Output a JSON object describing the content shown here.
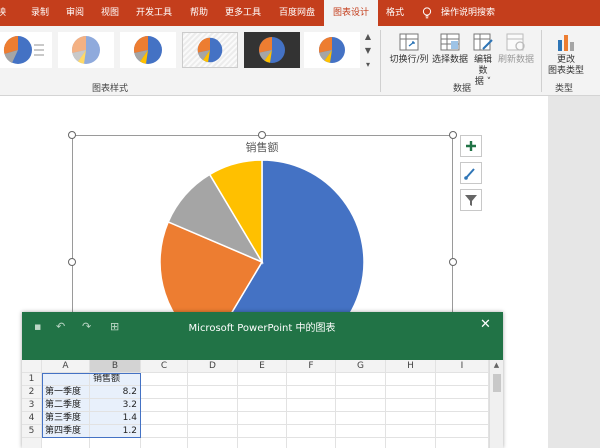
{
  "ribbon": {
    "tabs": [
      "映",
      "录制",
      "审阅",
      "视图",
      "开发工具",
      "帮助",
      "更多工具",
      "百度网盘",
      "图表设计",
      "格式"
    ],
    "active_tab": "图表设计",
    "search_label": "操作说明搜索",
    "groups": {
      "chart_styles": "图表样式",
      "data": "数据",
      "type": "类型"
    },
    "buttons": {
      "switch_row_col": "切换行/列",
      "select_data": "选择数据",
      "edit_data_line1": "编辑数",
      "edit_data_line2": "据 ˅",
      "refresh_data": "刷新数据",
      "change_type_line1": "更改",
      "change_type_line2": "图表类型"
    },
    "accent_color": "#c43e1c"
  },
  "chart": {
    "title": "销售额",
    "side_buttons": [
      "add-element-icon",
      "brush-icon",
      "filter-icon"
    ]
  },
  "chart_data": {
    "type": "pie",
    "title": "销售额",
    "categories": [
      "第一季度",
      "第二季度",
      "第三季度",
      "第四季度"
    ],
    "values": [
      8.2,
      3.2,
      1.4,
      1.2
    ],
    "colors": [
      "#4472c4",
      "#ed7d31",
      "#a5a5a5",
      "#ffc000"
    ]
  },
  "datasheet": {
    "title": "Microsoft PowerPoint 中的图表",
    "columns": [
      "A",
      "B",
      "C",
      "D",
      "E",
      "F",
      "G",
      "H",
      "I"
    ],
    "rows": [
      {
        "num": "1",
        "a": "",
        "b": "销售额"
      },
      {
        "num": "2",
        "a": "第一季度",
        "b": "8.2"
      },
      {
        "num": "3",
        "a": "第二季度",
        "b": "3.2"
      },
      {
        "num": "4",
        "a": "第三季度",
        "b": "1.4"
      },
      {
        "num": "5",
        "a": "第四季度",
        "b": "1.2"
      }
    ],
    "title_color": "#217346"
  }
}
